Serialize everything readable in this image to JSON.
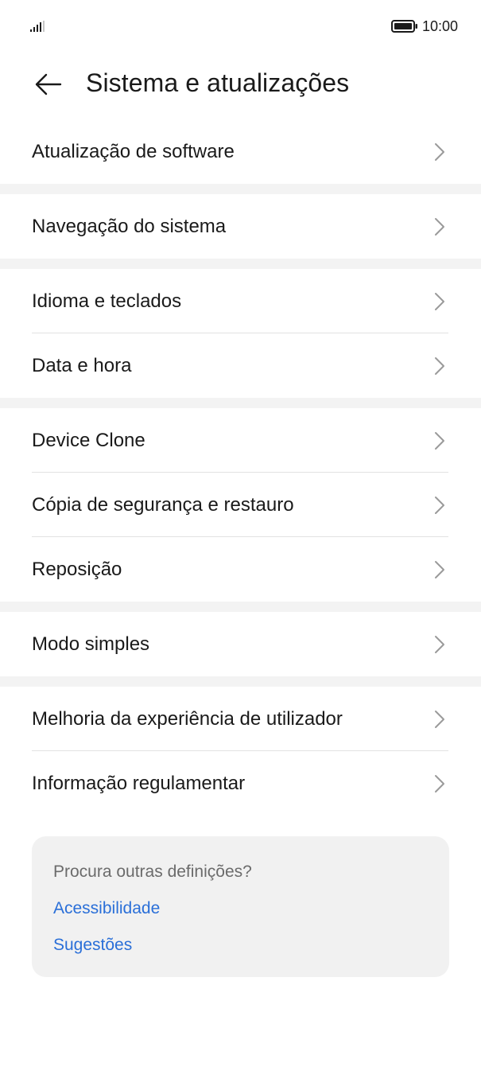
{
  "status_bar": {
    "time": "10:00",
    "signal_icon": "signal-icon",
    "battery_icon": "battery-icon"
  },
  "header": {
    "back_icon": "arrow-left-icon",
    "title": "Sistema e atualizações"
  },
  "groups": [
    {
      "items": [
        {
          "label": "Atualização de software",
          "icon": "chevron-right-icon"
        }
      ]
    },
    {
      "items": [
        {
          "label": "Navegação do sistema",
          "icon": "chevron-right-icon"
        }
      ]
    },
    {
      "items": [
        {
          "label": "Idioma e teclados",
          "icon": "chevron-right-icon"
        },
        {
          "label": "Data e hora",
          "icon": "chevron-right-icon"
        }
      ]
    },
    {
      "items": [
        {
          "label": "Device Clone",
          "icon": "chevron-right-icon"
        },
        {
          "label": "Cópia de segurança e restauro",
          "icon": "chevron-right-icon"
        },
        {
          "label": "Reposição",
          "icon": "chevron-right-icon"
        }
      ]
    },
    {
      "items": [
        {
          "label": "Modo simples",
          "icon": "chevron-right-icon"
        }
      ]
    },
    {
      "items": [
        {
          "label": "Melhoria da experiência de utilizador",
          "icon": "chevron-right-icon"
        },
        {
          "label": "Informação regulamentar",
          "icon": "chevron-right-icon"
        }
      ]
    }
  ],
  "suggestions_card": {
    "question": "Procura outras definições?",
    "links": [
      "Acessibilidade",
      "Sugestões"
    ]
  },
  "colors": {
    "text": "#1a1a1a",
    "link": "#2a6fd8",
    "muted": "#6b6b6b",
    "band": "#f3f3f3",
    "card_bg": "#f1f1f1"
  }
}
